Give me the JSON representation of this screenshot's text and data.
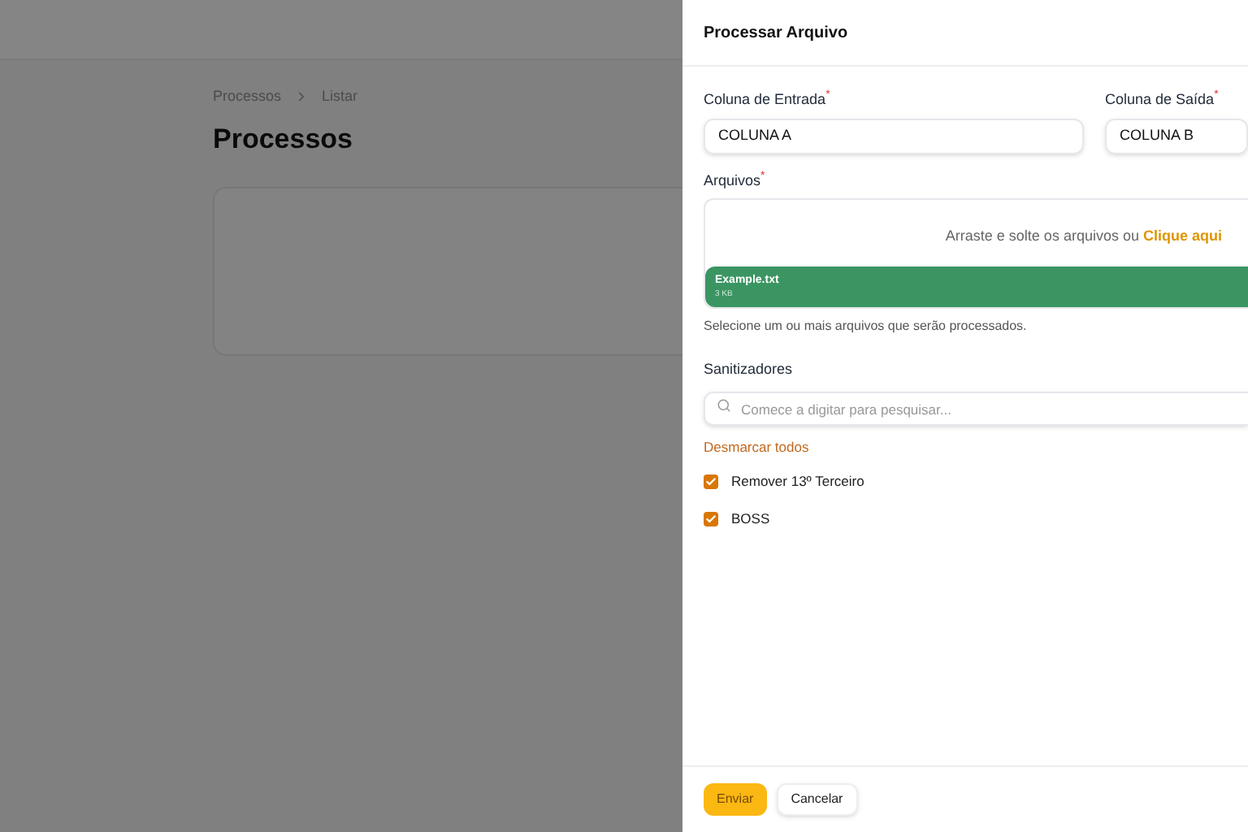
{
  "breadcrumb": [
    "Processos",
    "Listar"
  ],
  "page_title": "Processos",
  "drawer": {
    "title": "Processar Arquivo",
    "fields": [
      {
        "label": "Coluna de Entrada",
        "required_mark": "*",
        "value": "COLUNA A"
      },
      {
        "label": "Coluna de Saída",
        "required_mark": "*",
        "value": "COLUNA B"
      }
    ],
    "files": {
      "label": "Arquivos",
      "required_mark": "*",
      "dropzone_text": "Arraste e solte os arquivos ou",
      "dropzone_link": "Clique aqui",
      "items": [
        {
          "name": "Example.txt",
          "size": "3 KB"
        }
      ],
      "help": "Selecione um ou mais arquivos que serão processados."
    },
    "sanitizers": {
      "label": "Sanitizadores",
      "placeholder": "Comece a digitar para pesquisar...",
      "toggle_all": "Desmarcar todos",
      "options": [
        {
          "label": "Remover 13º Terceiro",
          "checked": true
        },
        {
          "label": "BOSS",
          "checked": true
        }
      ]
    },
    "buttons": [
      {
        "label": "Enviar",
        "kind": "primary"
      },
      {
        "label": "Cancelar",
        "kind": "secondary"
      }
    ]
  }
}
